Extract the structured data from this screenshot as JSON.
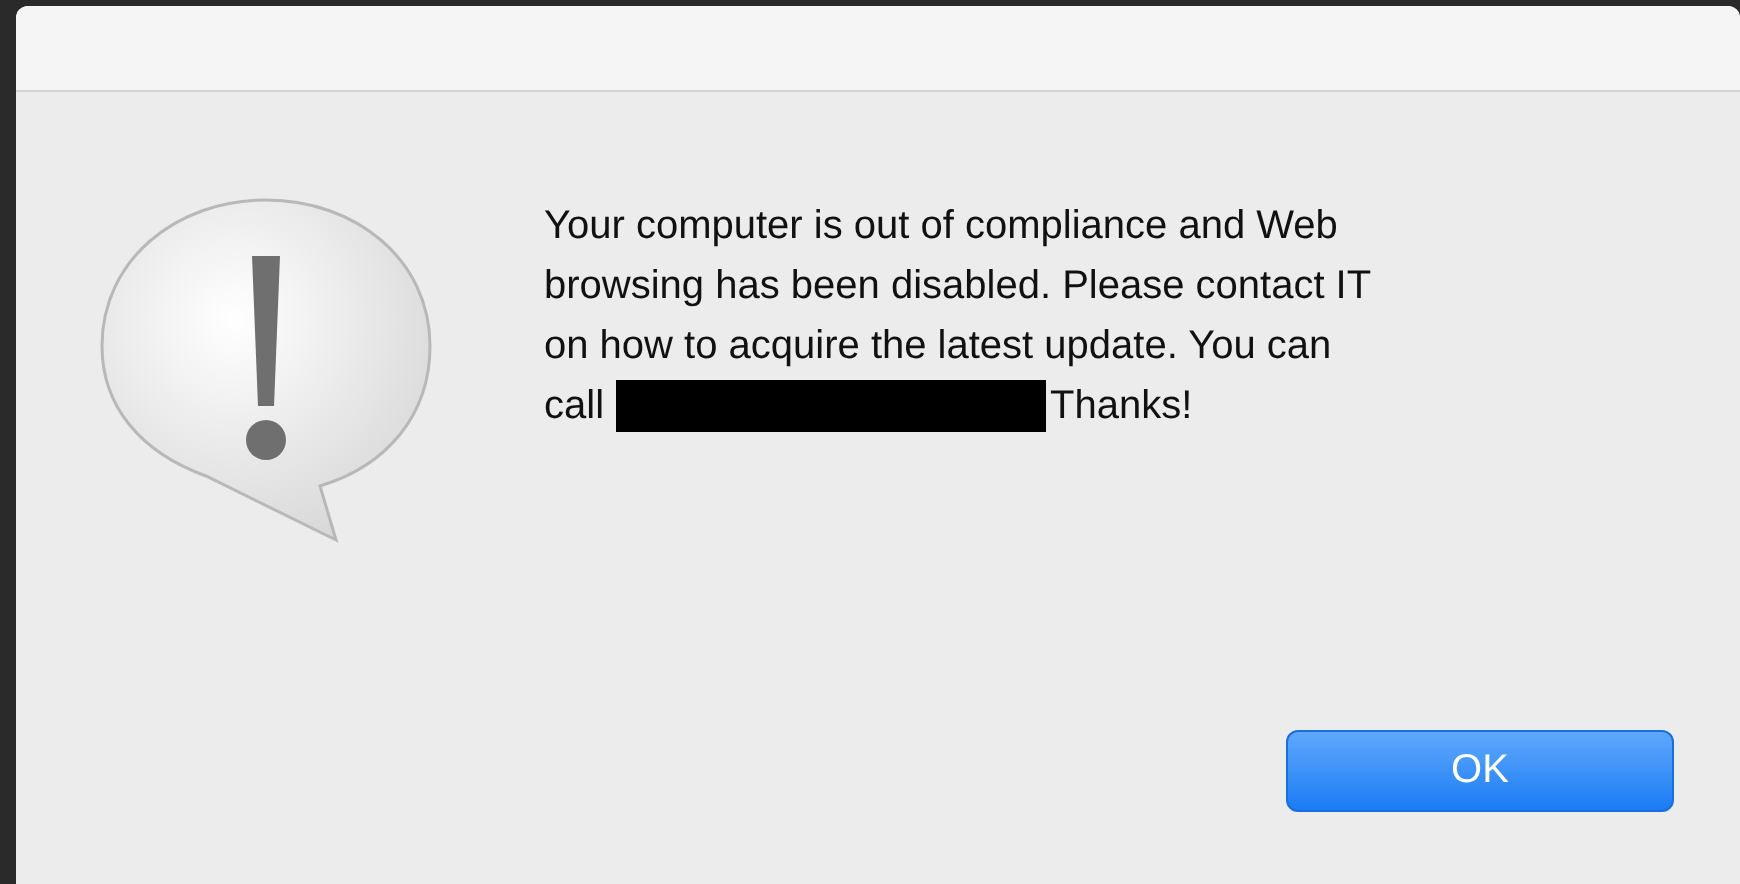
{
  "dialog": {
    "message_lines": [
      "Your computer is out of compliance and Web",
      "browsing has been disabled. Please contact IT",
      "on how to acquire the latest update. You can"
    ],
    "last_line_start": "call",
    "redacted": true,
    "last_line_end": "Thanks!",
    "buttons": [
      {
        "label": "OK",
        "default": true
      }
    ]
  }
}
